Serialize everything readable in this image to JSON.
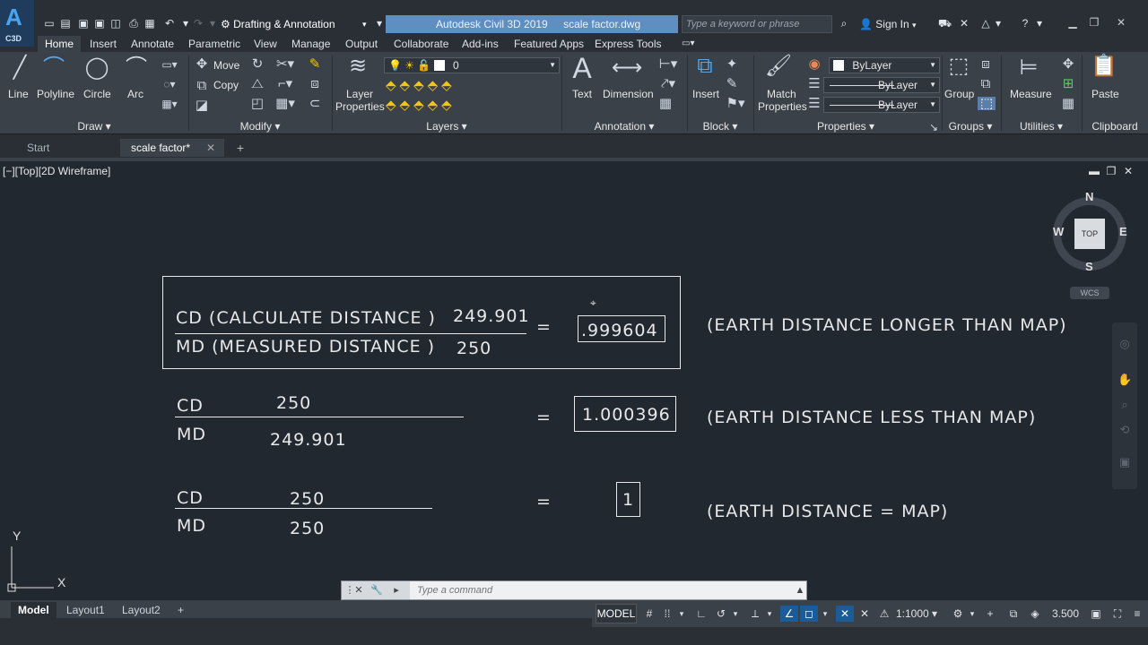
{
  "app": {
    "title": "Autodesk Civil 3D 2019",
    "file": "scale factor.dwg",
    "workspace": "Drafting & Annotation",
    "search_placeholder": "Type a keyword or phrase",
    "sign_in": "Sign In",
    "logo": "C3D"
  },
  "ribbon_tabs": [
    "Home",
    "Insert",
    "Annotate",
    "Parametric",
    "View",
    "Manage",
    "Output",
    "Collaborate",
    "Add-ins",
    "Featured Apps",
    "Express Tools"
  ],
  "ribbon": {
    "draw": {
      "line": "Line",
      "polyline": "Polyline",
      "circle": "Circle",
      "arc": "Arc",
      "footer": "Draw"
    },
    "modify": {
      "move": "Move",
      "copy": "Copy",
      "footer": "Modify"
    },
    "layers": {
      "layer_properties_1": "Layer",
      "layer_properties_2": "Properties",
      "current_layer": "0",
      "footer": "Layers"
    },
    "annotation": {
      "text": "Text",
      "dimension": "Dimension",
      "footer": "Annotation"
    },
    "block": {
      "insert": "Insert",
      "footer": "Block"
    },
    "properties": {
      "match_1": "Match",
      "match_2": "Properties",
      "color": "ByLayer",
      "linetype": "ByLayer",
      "lineweight": "ByLayer",
      "footer": "Properties"
    },
    "groups": {
      "group": "Group",
      "footer": "Groups"
    },
    "utilities": {
      "measure": "Measure",
      "footer": "Utilities"
    },
    "clipboard": {
      "paste": "Paste",
      "footer": "Clipboard"
    }
  },
  "file_tabs": {
    "start": "Start",
    "active": "scale factor*"
  },
  "viewport": {
    "label": "[−][Top][2D Wireframe]"
  },
  "drawing": {
    "row1": {
      "numerator_label": "CD (CALCULATE DISTANCE )",
      "numerator_value": "249.901",
      "denominator_label": "MD (MEASURED DISTANCE )",
      "denominator_value": "250",
      "result": ".999604",
      "note": "(EARTH DISTANCE LONGER THAN MAP)"
    },
    "row2": {
      "numerator_label": "CD",
      "numerator_value": "250",
      "denominator_label": "MD",
      "denominator_value": "249.901",
      "result": "1.000396",
      "note": "(EARTH DISTANCE LESS THAN MAP)"
    },
    "row3": {
      "numerator_label": "CD",
      "numerator_value": "250",
      "denominator_label": "MD",
      "denominator_value": "250",
      "result": "1",
      "note": "(EARTH DISTANCE = MAP)"
    },
    "equals": "="
  },
  "viewcube": {
    "north": "N",
    "south": "S",
    "east": "E",
    "west": "W",
    "face": "TOP",
    "wcs": "WCS"
  },
  "ucs": {
    "x": "X",
    "y": "Y"
  },
  "command": {
    "placeholder": "Type a command"
  },
  "layout_tabs": [
    "Model",
    "Layout1",
    "Layout2"
  ],
  "status": {
    "model": "MODEL",
    "scale": "1:1000",
    "annotation_value": "3.500"
  }
}
